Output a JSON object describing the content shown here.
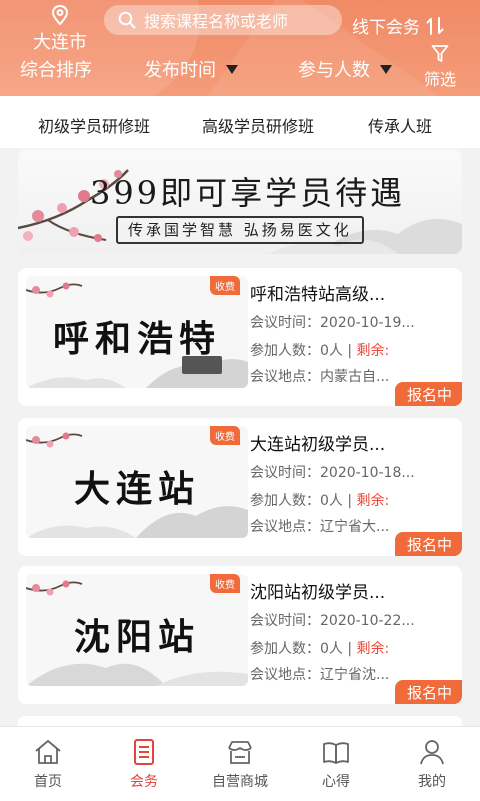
{
  "header": {
    "city": "大连市",
    "search_placeholder": "搜索课程名称或老师",
    "offline_label": "线下会务",
    "sort_default": "综合排序",
    "sort_time": "发布时间",
    "sort_people": "参与人数",
    "filter_label": "筛选"
  },
  "categories": [
    "初级学员研修班",
    "高级学员研修班",
    "传承人班"
  ],
  "banner": {
    "title": "399即可享学员待遇",
    "subtitle": "传承国学智慧 弘扬易医文化"
  },
  "courses": [
    {
      "art_text": "呼和浩特",
      "badge": "收费",
      "title": "呼和浩特站高级...",
      "time_label": "会议时间：",
      "time_value": "2020-10-19...",
      "count_label": "参加人数：",
      "count_value": "0人 | ",
      "remaining_label": "剩余:",
      "place_label": "会议地点：",
      "place_value": "内蒙古自...",
      "status": "报名中"
    },
    {
      "art_text": "大连站",
      "badge": "收费",
      "title": "大连站初级学员...",
      "time_label": "会议时间：",
      "time_value": "2020-10-18...",
      "count_label": "参加人数：",
      "count_value": "0人 | ",
      "remaining_label": "剩余:",
      "place_label": "会议地点：",
      "place_value": "辽宁省大...",
      "status": "报名中"
    },
    {
      "art_text": "沈阳站",
      "badge": "收费",
      "title": "沈阳站初级学员...",
      "time_label": "会议时间：",
      "time_value": "2020-10-22...",
      "count_label": "参加人数：",
      "count_value": "0人 | ",
      "remaining_label": "剩余:",
      "place_label": "会议地点：",
      "place_value": "辽宁省沈...",
      "status": "报名中"
    }
  ],
  "nav": [
    {
      "label": "首页",
      "icon": "home-icon",
      "active": false
    },
    {
      "label": "会务",
      "icon": "document-icon",
      "active": true
    },
    {
      "label": "自营商城",
      "icon": "store-icon",
      "active": false
    },
    {
      "label": "心得",
      "icon": "book-icon",
      "active": false
    },
    {
      "label": "我的",
      "icon": "user-icon",
      "active": false
    }
  ],
  "colors": {
    "header_gradient_top": "#f08a66",
    "accent": "#f06a3a",
    "remaining_text": "#e84a3a",
    "nav_active": "#e2463a"
  }
}
